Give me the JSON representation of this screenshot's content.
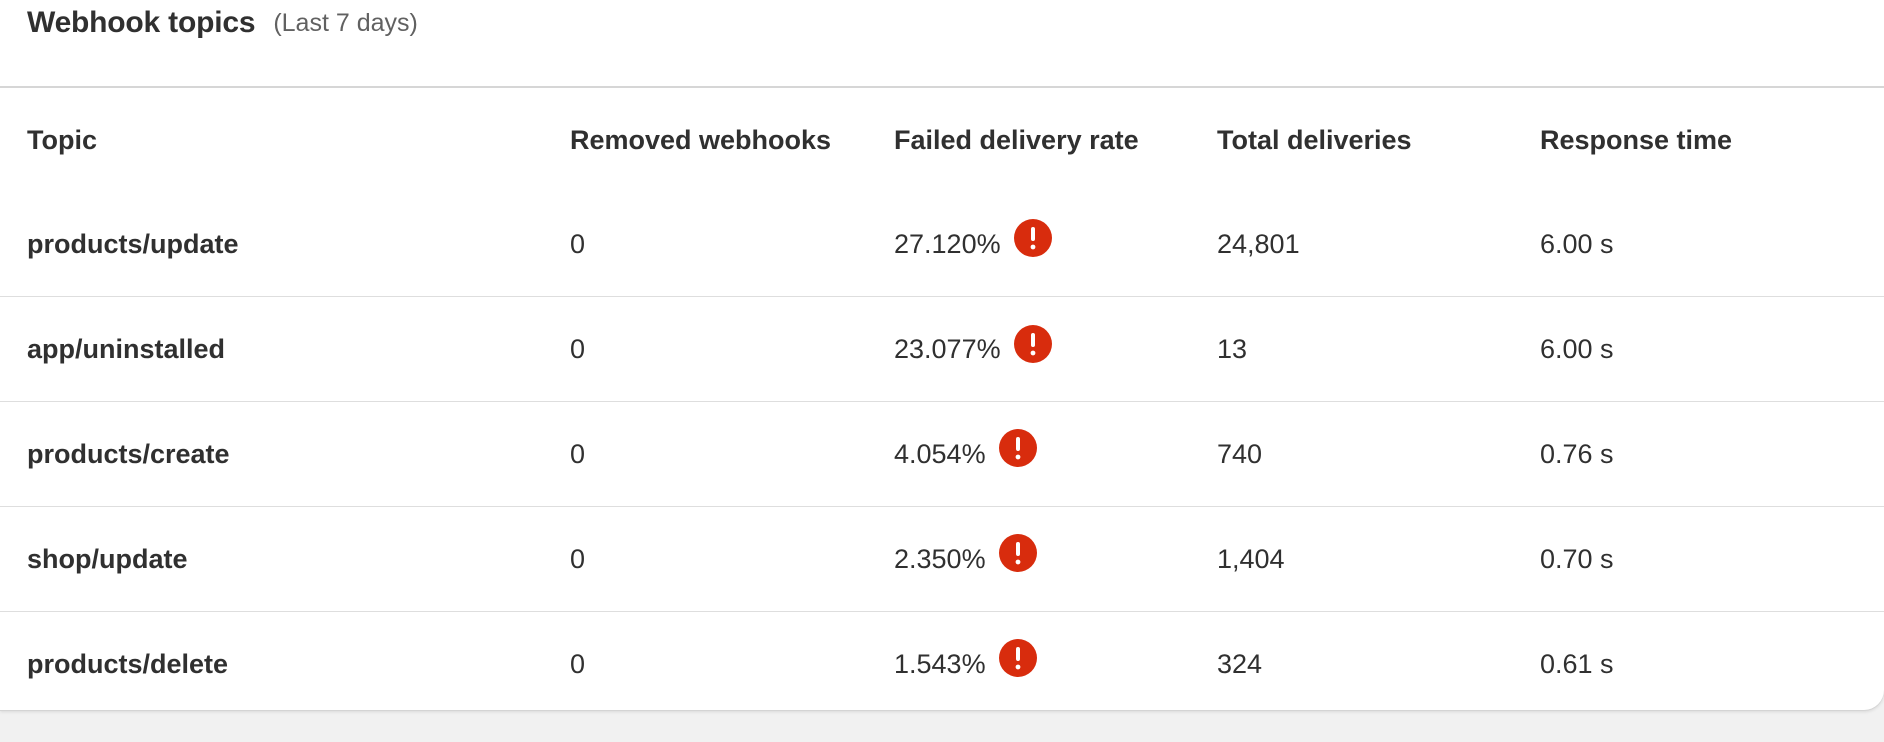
{
  "header": {
    "title": "Webhook topics",
    "subtitle": "(Last 7 days)"
  },
  "table": {
    "columns": [
      "Topic",
      "Removed webhooks",
      "Failed delivery rate",
      "Total deliveries",
      "Response time"
    ],
    "rows": [
      {
        "topic": "products/update",
        "removed": "0",
        "failed_rate": "27.120%",
        "total": "24,801",
        "response": "6.00 s",
        "alert_icon": "exclamation-circle-icon"
      },
      {
        "topic": "app/uninstalled",
        "removed": "0",
        "failed_rate": "23.077%",
        "total": "13",
        "response": "6.00 s",
        "alert_icon": "exclamation-circle-icon"
      },
      {
        "topic": "products/create",
        "removed": "0",
        "failed_rate": "4.054%",
        "total": "740",
        "response": "0.76 s",
        "alert_icon": "exclamation-circle-icon"
      },
      {
        "topic": "shop/update",
        "removed": "0",
        "failed_rate": "2.350%",
        "total": "1,404",
        "response": "0.70 s",
        "alert_icon": "exclamation-circle-icon"
      },
      {
        "topic": "products/delete",
        "removed": "0",
        "failed_rate": "1.543%",
        "total": "324",
        "response": "0.61 s",
        "alert_icon": "exclamation-circle-icon"
      }
    ]
  },
  "colors": {
    "alert": "#d82c0d",
    "text": "#303030",
    "subdued": "#616161",
    "divider": "#dedede"
  }
}
